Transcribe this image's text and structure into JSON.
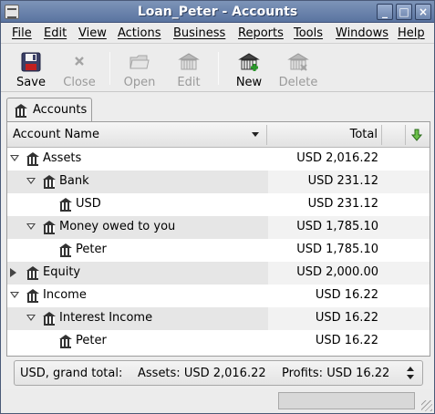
{
  "window": {
    "title": "Loan_Peter - Accounts",
    "buttons": {
      "minimize": "_",
      "maximize": "□",
      "close": "×"
    }
  },
  "menu": {
    "items": [
      {
        "label": "File"
      },
      {
        "label": "Edit"
      },
      {
        "label": "View"
      },
      {
        "label": "Actions"
      },
      {
        "label": "Business"
      },
      {
        "label": "Reports"
      },
      {
        "label": "Tools"
      },
      {
        "label": "Windows"
      },
      {
        "label": "Help"
      }
    ]
  },
  "toolbar": {
    "save": "Save",
    "close": "Close",
    "open": "Open",
    "edit": "Edit",
    "new": "New",
    "delete": "Delete"
  },
  "tabs": [
    {
      "label": "Accounts"
    }
  ],
  "table": {
    "columns": {
      "name": "Account Name",
      "total": "Total"
    },
    "rows": [
      {
        "name": "Assets",
        "total": "USD 2,016.22",
        "depth": 0,
        "expander": "open"
      },
      {
        "name": "Bank",
        "total": "USD 231.12",
        "depth": 1,
        "expander": "open"
      },
      {
        "name": "USD",
        "total": "USD 231.12",
        "depth": 2,
        "expander": "none"
      },
      {
        "name": "Money owed to you",
        "total": "USD 1,785.10",
        "depth": 1,
        "expander": "open"
      },
      {
        "name": "Peter",
        "total": "USD 1,785.10",
        "depth": 2,
        "expander": "none"
      },
      {
        "name": "Equity",
        "total": "USD 2,000.00",
        "depth": 0,
        "expander": "closed"
      },
      {
        "name": "Income",
        "total": "USD 16.22",
        "depth": 0,
        "expander": "open"
      },
      {
        "name": "Interest Income",
        "total": "USD 16.22",
        "depth": 1,
        "expander": "open"
      },
      {
        "name": "Peter",
        "total": "USD 16.22",
        "depth": 2,
        "expander": "none"
      }
    ]
  },
  "summary": {
    "currency": "USD, grand total:",
    "assets": "Assets: USD 2,016.22",
    "profits": "Profits: USD 16.22"
  },
  "colors": {
    "titlebar": "#5a74a0",
    "new_icon_plus": "#2a9a2a",
    "sort_arrow": "#3a8a2a"
  }
}
